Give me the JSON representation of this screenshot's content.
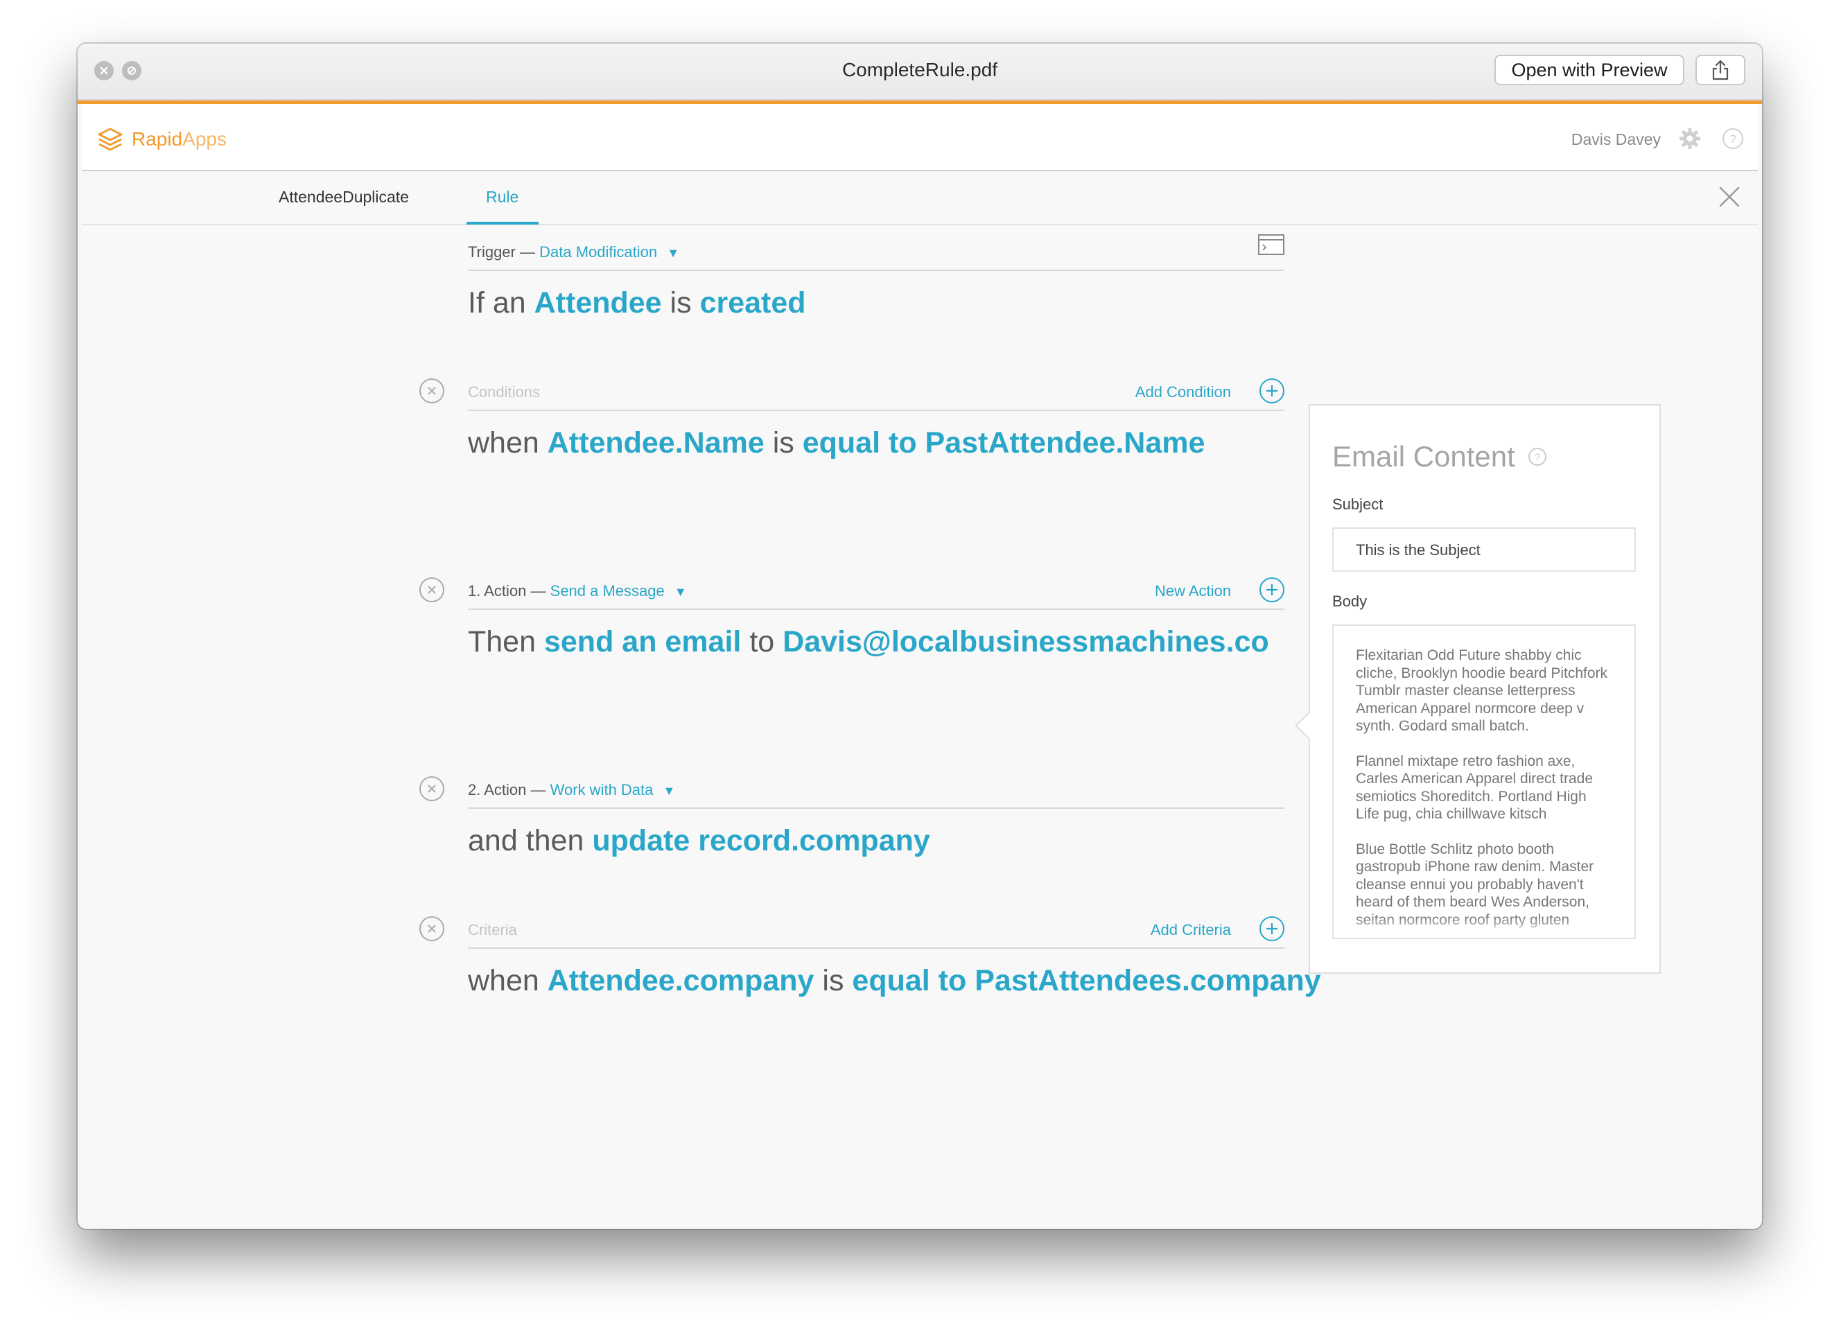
{
  "window": {
    "title": "CompleteRule.pdf",
    "open_with_preview": "Open with Preview"
  },
  "app": {
    "brand_prefix": "Rapid",
    "brand_suffix": "Apps",
    "user_name": "Davis Davey"
  },
  "tabs": [
    {
      "label": "AttendeeDuplicate",
      "active": false
    },
    {
      "label": "Rule",
      "active": true
    }
  ],
  "trigger": {
    "label": "Trigger",
    "dash": "—",
    "type": "Data Modification",
    "sentence": {
      "w1": "If an",
      "k1": "Attendee",
      "w2": "is",
      "k2": "created"
    }
  },
  "conditions": {
    "label": "Conditions",
    "add_label": "Add Condition",
    "sentence": {
      "w1": "when",
      "k1": "Attendee.Name",
      "w2": "is",
      "k2": "equal to",
      "k3": "PastAttendee.Name"
    }
  },
  "action1": {
    "label": "1. Action",
    "dash": "—",
    "type": "Send a Message",
    "add_label": "New Action",
    "sentence": {
      "w1": "Then",
      "k1": "send an email",
      "w2": "to",
      "k2": "Davis@localbusinessmachines.co"
    }
  },
  "action2": {
    "label": "2. Action",
    "dash": "—",
    "type": "Work with Data",
    "sentence": {
      "w1": "and then",
      "k1": "update record.company"
    }
  },
  "criteria": {
    "label": "Criteria",
    "add_label": "Add Criteria",
    "sentence": {
      "w1": "when",
      "k1": "Attendee.company",
      "w2": "is",
      "k2": "equal to",
      "k3": "PastAttendees.company"
    }
  },
  "email_panel": {
    "title": "Email Content",
    "subject_label": "Subject",
    "subject_value": "This is the Subject",
    "body_label": "Body",
    "body_paragraphs": [
      "Flexitarian Odd Future shabby chic cliche, Brooklyn hoodie beard Pitchfork Tumblr master cleanse letterpress American Apparel normcore deep v synth.  Godard small batch.",
      "Flannel mixtape retro fashion axe, Carles American Apparel direct trade semiotics Shoreditch.  Portland High Life pug, chia chillwave kitsch",
      "Blue Bottle Schlitz photo booth gastropub iPhone raw denim.  Master cleanse ennui you probably haven't heard of them beard Wes Anderson, seitan normcore roof party gluten"
    ]
  },
  "colors": {
    "accent": "#2aa6c8",
    "brand": "#f39a2c"
  }
}
